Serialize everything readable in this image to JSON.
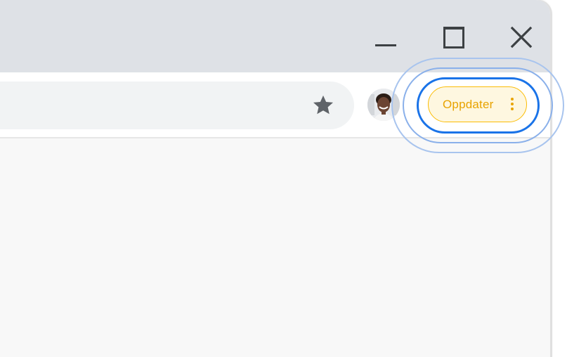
{
  "window_controls": {
    "minimize_icon": "minimize-icon",
    "maximize_icon": "maximize-icon",
    "close_icon": "close-icon"
  },
  "toolbar": {
    "bookmark_icon": "star-icon",
    "profile_icon": "avatar",
    "update_button": {
      "label": "Oppdater",
      "menu_icon": "kebab-menu-icon"
    }
  },
  "colors": {
    "titlebar": "#dee1e6",
    "toolbar": "#ffffff",
    "omnibox": "#f1f3f4",
    "content": "#f8f8f8",
    "update_text": "#e8a300",
    "update_border": "#fbbc04",
    "update_fill": "#fef7e0",
    "focus_ring": "#1a73e8"
  }
}
